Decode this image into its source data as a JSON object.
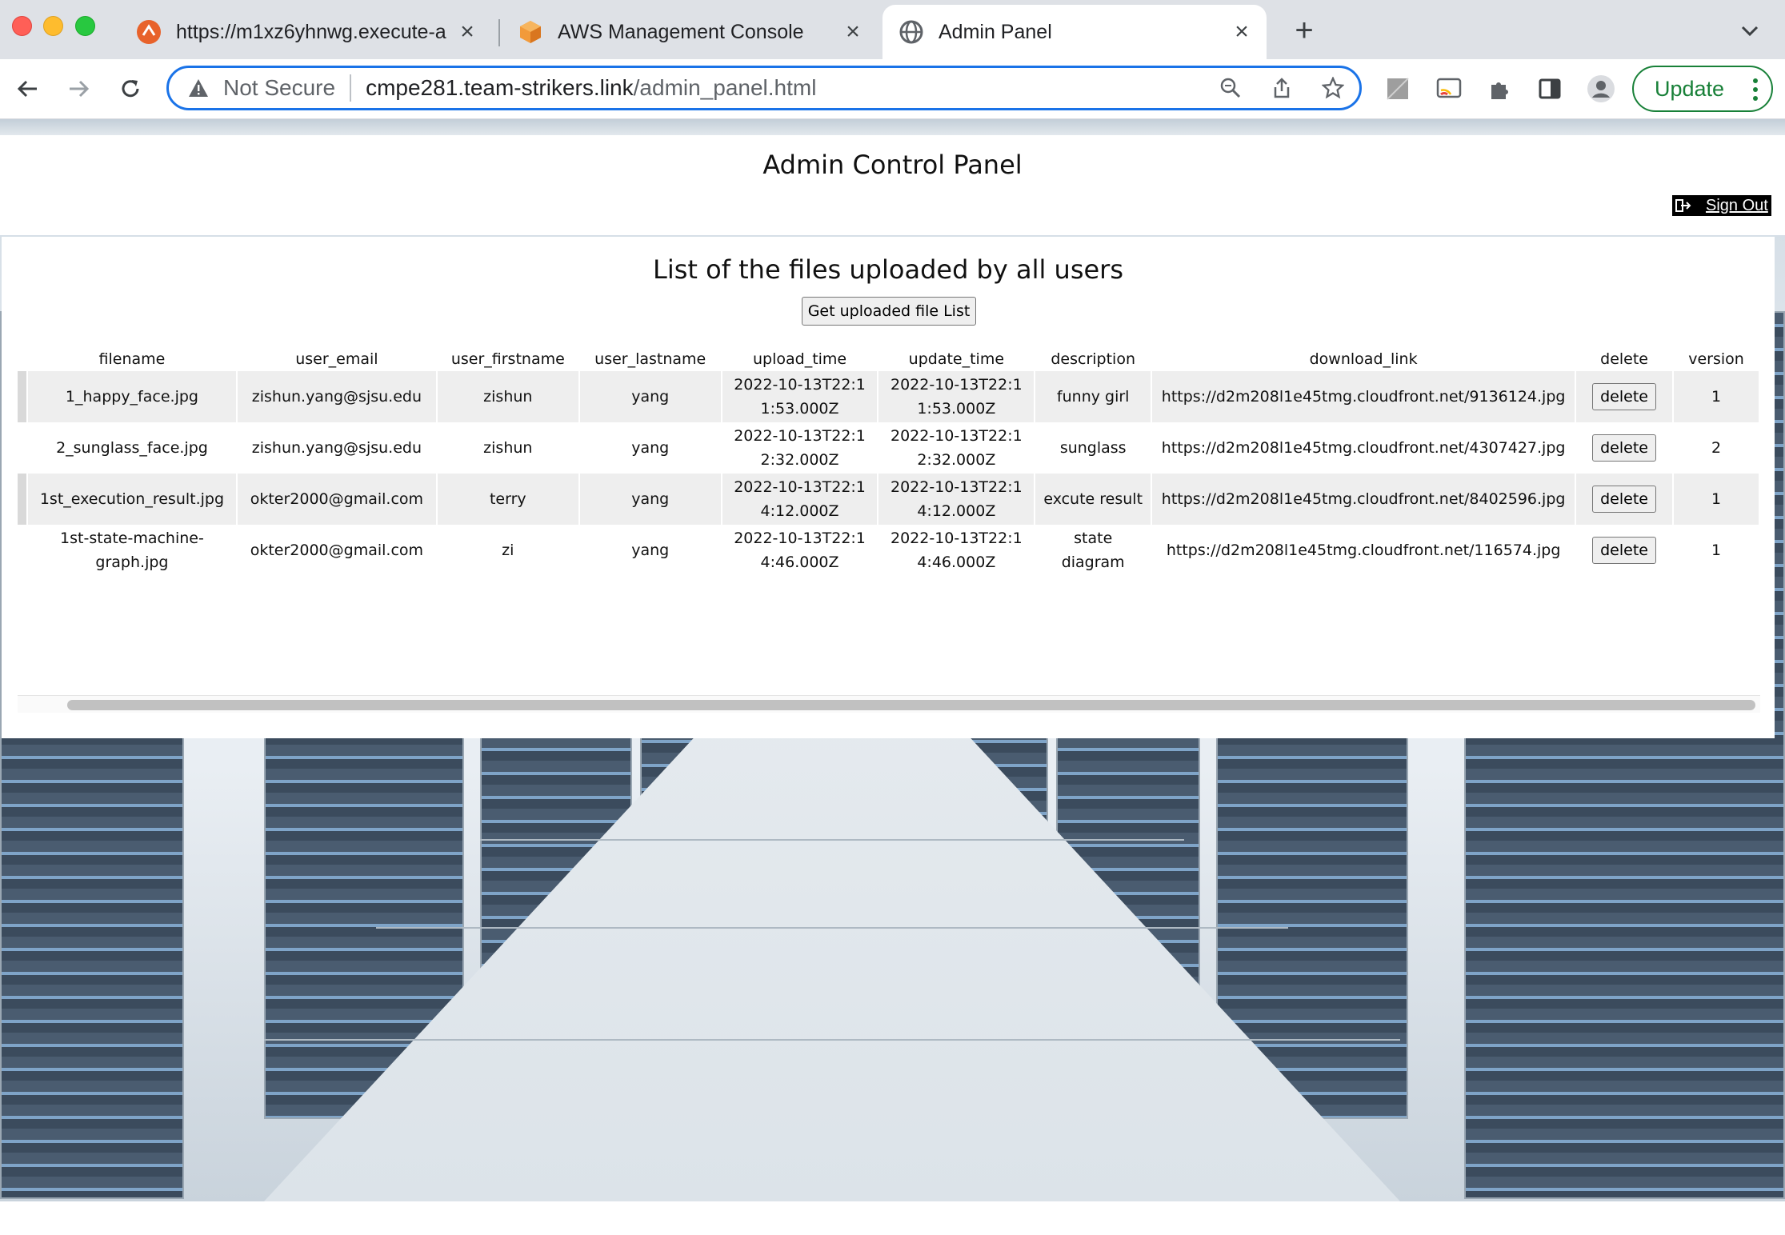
{
  "browser": {
    "tabs": [
      {
        "title": "https://m1xz6yhnwg.execute-a",
        "icon": "api-gateway-icon"
      },
      {
        "title": "AWS Management Console",
        "icon": "aws-cube-icon"
      },
      {
        "title": "Admin Panel",
        "icon": "globe-icon",
        "active": true
      }
    ],
    "address": {
      "security_label": "Not Secure",
      "host": "cmpe281.team-strikers.link",
      "path": "/admin_panel.html"
    },
    "update_label": "Update"
  },
  "page": {
    "title": "Admin Control Panel",
    "signout_label": "Sign Out",
    "files_heading": "List of the files uploaded by all users",
    "get_list_button": "Get uploaded file List",
    "table": {
      "headers": [
        "filename",
        "user_email",
        "user_firstname",
        "user_lastname",
        "upload_time",
        "update_time",
        "description",
        "download_link",
        "delete",
        "version"
      ],
      "rows": [
        {
          "filename": "1_happy_face.jpg",
          "email": "zishun.yang@sjsu.edu",
          "firstname": "zishun",
          "lastname": "yang",
          "upload_time": "2022-10-13T22:11:53.000Z",
          "update_time": "2022-10-13T22:11:53.000Z",
          "description": "funny girl",
          "link": "https://d2m208l1e45tmg.cloudfront.net/9136124.jpg",
          "delete": "delete",
          "version": "1"
        },
        {
          "filename": "2_sunglass_face.jpg",
          "email": "zishun.yang@sjsu.edu",
          "firstname": "zishun",
          "lastname": "yang",
          "upload_time": "2022-10-13T22:12:32.000Z",
          "update_time": "2022-10-13T22:12:32.000Z",
          "description": "sunglass",
          "link": "https://d2m208l1e45tmg.cloudfront.net/4307427.jpg",
          "delete": "delete",
          "version": "2"
        },
        {
          "filename": "1st_execution_result.jpg",
          "email": "okter2000@gmail.com",
          "firstname": "terry",
          "lastname": "yang",
          "upload_time": "2022-10-13T22:14:12.000Z",
          "update_time": "2022-10-13T22:14:12.000Z",
          "description": "excute result",
          "link": "https://d2m208l1e45tmg.cloudfront.net/8402596.jpg",
          "delete": "delete",
          "version": "1"
        },
        {
          "filename": "1st-state-machine-graph.jpg",
          "email": "okter2000@gmail.com",
          "firstname": "zi",
          "lastname": "yang",
          "upload_time": "2022-10-13T22:14:46.000Z",
          "update_time": "2022-10-13T22:14:46.000Z",
          "description": "state diagram",
          "link": "https://d2m208l1e45tmg.cloudfront.net/116574.jpg",
          "delete": "delete",
          "version": "1"
        }
      ]
    }
  },
  "colors": {
    "accent_blue": "#1a73e8",
    "update_green": "#188038",
    "row_alt": "#eeeeee"
  }
}
